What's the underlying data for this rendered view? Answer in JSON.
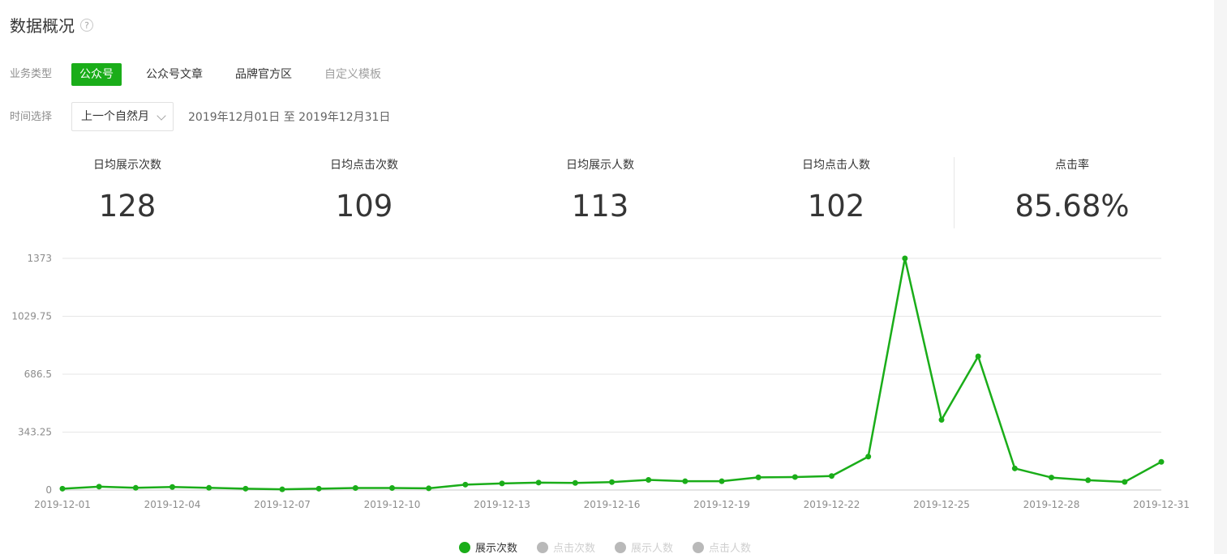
{
  "header": {
    "title": "数据概况",
    "help_icon_text": "?"
  },
  "filters": {
    "type_label": "业务类型",
    "types": [
      {
        "label": "公众号",
        "state": "active"
      },
      {
        "label": "公众号文章",
        "state": "normal"
      },
      {
        "label": "品牌官方区",
        "state": "normal"
      },
      {
        "label": "自定义模板",
        "state": "disabled"
      }
    ],
    "time_label": "时间选择",
    "time_select_value": "上一个自然月",
    "date_range": "2019年12月01日 至 2019年12月31日"
  },
  "metrics": [
    {
      "title": "日均展示次数",
      "value": "128"
    },
    {
      "title": "日均点击次数",
      "value": "109"
    },
    {
      "title": "日均展示人数",
      "value": "113"
    },
    {
      "title": "日均点击人数",
      "value": "102"
    },
    {
      "title": "点击率",
      "value": "85.68%"
    }
  ],
  "colors": {
    "accent": "#1aad19",
    "inactive": "#b9b9b9",
    "grid": "#e6e6e6"
  },
  "chart_data": {
    "type": "line",
    "x": [
      "2019-12-01",
      "2019-12-02",
      "2019-12-03",
      "2019-12-04",
      "2019-12-05",
      "2019-12-06",
      "2019-12-07",
      "2019-12-08",
      "2019-12-09",
      "2019-12-10",
      "2019-12-11",
      "2019-12-12",
      "2019-12-13",
      "2019-12-14",
      "2019-12-15",
      "2019-12-16",
      "2019-12-17",
      "2019-12-18",
      "2019-12-19",
      "2019-12-20",
      "2019-12-21",
      "2019-12-22",
      "2019-12-23",
      "2019-12-24",
      "2019-12-25",
      "2019-12-26",
      "2019-12-27",
      "2019-12-28",
      "2019-12-29",
      "2019-12-30",
      "2019-12-31"
    ],
    "x_tick_labels": [
      "2019-12-01",
      "2019-12-04",
      "2019-12-07",
      "2019-12-10",
      "2019-12-13",
      "2019-12-16",
      "2019-12-19",
      "2019-12-22",
      "2019-12-25",
      "2019-12-28",
      "2019-12-31"
    ],
    "y_ticks": [
      "0",
      "343.25",
      "686.5",
      "1029.75",
      "1373"
    ],
    "ylim": [
      0,
      1373
    ],
    "grid": true,
    "legend_position": "bottom-center",
    "series": [
      {
        "name": "展示次数",
        "active": true,
        "values": [
          8,
          20,
          13,
          18,
          13,
          8,
          4,
          8,
          12,
          12,
          10,
          32,
          39,
          44,
          42,
          47,
          60,
          52,
          52,
          75,
          77,
          83,
          198,
          1373,
          416,
          792,
          128,
          74,
          58,
          48,
          167
        ]
      },
      {
        "name": "点击次数",
        "active": false
      },
      {
        "name": "展示人数",
        "active": false
      },
      {
        "name": "点击人数",
        "active": false
      }
    ]
  }
}
